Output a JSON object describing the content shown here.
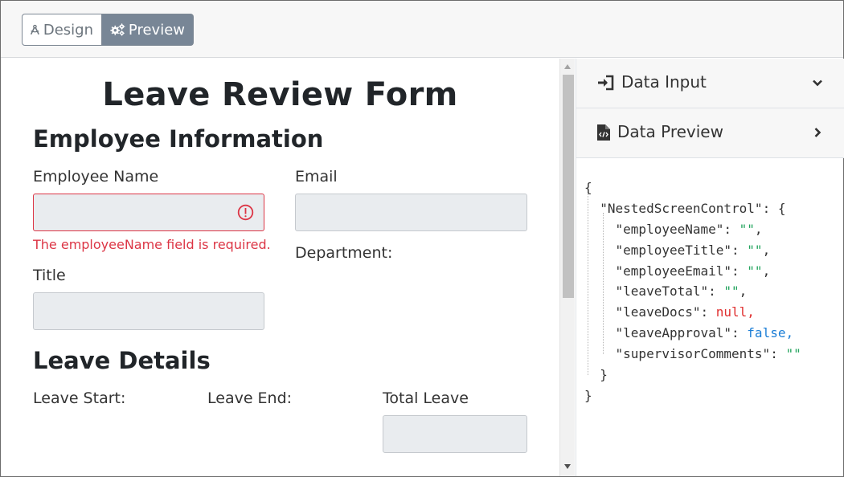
{
  "toolbar": {
    "design_label": "Design",
    "preview_label": "Preview"
  },
  "form": {
    "title": "Leave Review Form",
    "employee_section": "Employee Information",
    "employee_name_label": "Employee Name",
    "employee_name_error": "The employeeName field is required.",
    "email_label": "Email",
    "department_label": "Department:",
    "title_label": "Title",
    "leave_section": "Leave Details",
    "leave_start_label": "Leave Start:",
    "leave_end_label": "Leave End:",
    "total_leave_label": "Total Leave"
  },
  "panel": {
    "data_input_label": "Data Input",
    "data_preview_label": "Data Preview"
  },
  "json_preview": {
    "open_brace": "{",
    "root_key": "\"NestedScreenControl\"",
    "root_open": ": {",
    "fields": [
      {
        "key": "\"employeeName\"",
        "value": "\"\"",
        "type": "string",
        "comma": ","
      },
      {
        "key": "\"employeeTitle\"",
        "value": "\"\"",
        "type": "string",
        "comma": ","
      },
      {
        "key": "\"employeeEmail\"",
        "value": "\"\"",
        "type": "string",
        "comma": ","
      },
      {
        "key": "\"leaveTotal\"",
        "value": "\"\"",
        "type": "string",
        "comma": ","
      },
      {
        "key": "\"leaveDocs\"",
        "value": "null",
        "type": "null",
        "comma": ","
      },
      {
        "key": "\"leaveApproval\"",
        "value": "false",
        "type": "boolean",
        "comma": ","
      },
      {
        "key": "\"supervisorComments\"",
        "value": "\"\"",
        "type": "string",
        "comma": ""
      }
    ],
    "inner_close": "}",
    "close_brace": "}"
  },
  "colors": {
    "accent_button": "#788696",
    "error": "#dc3545",
    "json_string": "#22a45d",
    "json_null": "#e03131",
    "json_boolean": "#1c7ed6"
  }
}
